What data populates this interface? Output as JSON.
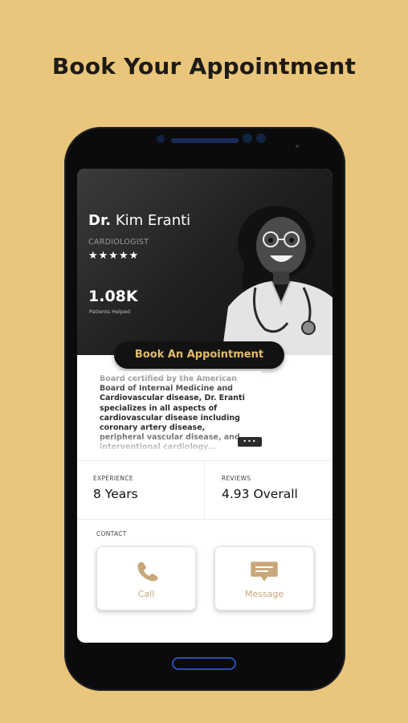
{
  "page": {
    "headline": "Book Your Appointment"
  },
  "doctor": {
    "prefix": "Dr.",
    "name": "Kim Eranti",
    "specialty": "CARDIOLOGIST",
    "rating_stars": "★★★★★",
    "patients_value": "1.08K",
    "patients_label": "Patients Helped"
  },
  "book_button": {
    "label": "Book An Appointment"
  },
  "bio": {
    "text": "Board certified by the American Board of Internal Medicine and Cardiovascular disease, Dr. Eranti specializes in all aspects of cardiovascular disease including coronary artery disease, peripheral vascular disease, and interventional cardiology...",
    "more_label": "•••"
  },
  "stats": {
    "experience_label": "EXPERIENCE",
    "experience_value": "8 Years",
    "reviews_label": "REVIEWS",
    "reviews_value": "4.93 Overall"
  },
  "contact": {
    "label": "CONTACT",
    "call_label": "Call",
    "message_label": "Message"
  },
  "colors": {
    "background": "#e9c67c",
    "accent_gold": "#e4bc6c",
    "icon_tan": "#c8a77a"
  },
  "icons": [
    "phone-icon",
    "message-icon"
  ]
}
